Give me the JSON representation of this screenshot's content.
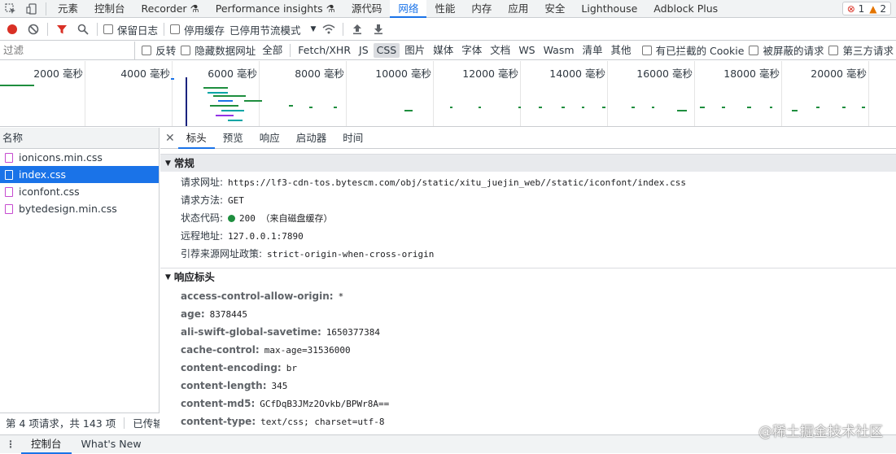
{
  "main_tabs": {
    "items": [
      "元素",
      "控制台",
      "Recorder",
      "Performance insights",
      "源代码",
      "网络",
      "性能",
      "内存",
      "应用",
      "安全",
      "Lighthouse",
      "Adblock Plus"
    ],
    "active": "网络",
    "errors": "1",
    "warnings": "2"
  },
  "toolbar": {
    "preserve_log": "保留日志",
    "disable_cache": "停用缓存",
    "throttling": "已停用节流模式"
  },
  "filter": {
    "placeholder": "过滤",
    "invert": "反转",
    "hide_data_urls": "隐藏数据网址",
    "all": "全部",
    "types": [
      "Fetch/XHR",
      "JS",
      "CSS",
      "图片",
      "媒体",
      "字体",
      "文档",
      "WS",
      "Wasm",
      "清单",
      "其他"
    ],
    "active_type": "CSS",
    "blocked_cookies": "有已拦截的 Cookie",
    "blocked_requests": "被屏蔽的请求",
    "third_party": "第三方请求"
  },
  "overview": {
    "tick_labels": [
      "2000 毫秒",
      "4000 毫秒",
      "6000 毫秒",
      "8000 毫秒",
      "10000 毫秒",
      "12000 毫秒",
      "14000 毫秒",
      "16000 毫秒",
      "18000 毫秒",
      "20000 毫秒"
    ],
    "colors": {
      "green": "#1e8e3e",
      "teal": "#00a5a5",
      "blue": "#1a73e8",
      "purple": "#9334e6",
      "navy": "#1a237e"
    }
  },
  "request_list": {
    "header": "名称",
    "items": [
      "ionicons.min.css",
      "index.css",
      "iconfont.css",
      "bytedesign.min.css"
    ],
    "selected_index": 1,
    "footer": "第 4 项请求，共 143 项",
    "footer_transferred": "已传输 ("
  },
  "detail_tabs": {
    "items": [
      "标头",
      "预览",
      "响应",
      "启动器",
      "时间"
    ],
    "active": "标头"
  },
  "general": {
    "title": "常规",
    "rows": [
      {
        "key": "请求网址:",
        "value": "https://lf3-cdn-tos.bytescm.com/obj/static/xitu_juejin_web//static/iconfont/index.css"
      },
      {
        "key": "请求方法:",
        "value": "GET"
      },
      {
        "key": "状态代码:",
        "value": "200  （来自磁盘缓存）"
      },
      {
        "key": "远程地址:",
        "value": "127.0.0.1:7890"
      },
      {
        "key": "引荐来源网址政策:",
        "value": "strict-origin-when-cross-origin"
      }
    ]
  },
  "response_headers": {
    "title": "响应标头",
    "rows": [
      {
        "key": "access-control-allow-origin:",
        "value": "*"
      },
      {
        "key": "age:",
        "value": "8378445"
      },
      {
        "key": "ali-swift-global-savetime:",
        "value": "1650377384"
      },
      {
        "key": "cache-control:",
        "value": "max-age=31536000"
      },
      {
        "key": "content-encoding:",
        "value": "br"
      },
      {
        "key": "content-length:",
        "value": "345"
      },
      {
        "key": "content-md5:",
        "value": "GCfDqB3JMz2Ovkb/BPWr8A=="
      },
      {
        "key": "content-type:",
        "value": "text/css; charset=utf-8"
      }
    ]
  },
  "drawer": {
    "tabs": [
      "控制台",
      "What's New"
    ],
    "active": "控制台"
  },
  "watermark": "@稀土掘金技术社区"
}
